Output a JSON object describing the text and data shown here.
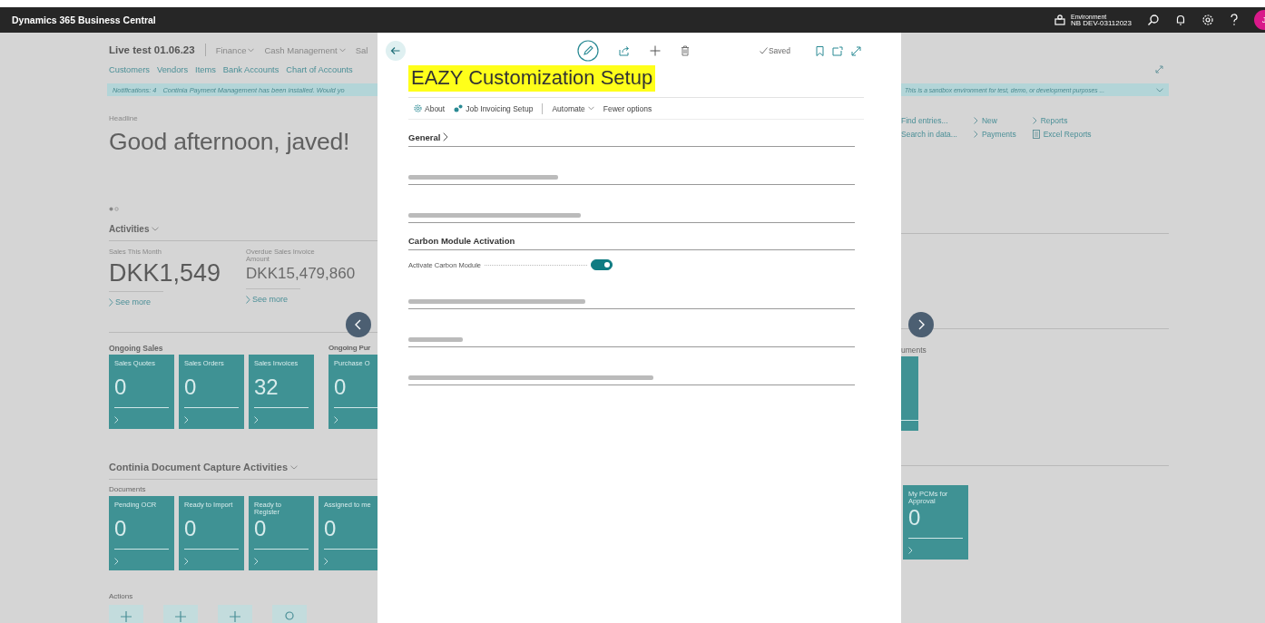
{
  "top_bar": {
    "app_name": "Dynamics 365 Business Central",
    "environment_label": "Environment",
    "environment_name": "NB DEV-03112023",
    "avatar_initial": "J"
  },
  "dashboard": {
    "company": "Live test 01.06.23",
    "menus": [
      {
        "label": "Finance",
        "menu": true
      },
      {
        "label": "Cash Management",
        "menu": true
      },
      {
        "label": "Sal",
        "menu": false
      }
    ],
    "links": [
      "Customers",
      "Vendors",
      "Items",
      "Bank Accounts",
      "Chart of Accounts"
    ],
    "notification": {
      "label": "Notifications: 4",
      "message": "Continia Payment Management has been installed. Would yo"
    },
    "sandbox_banner": "This is a sandbox environment for test, demo, or development purposes ...",
    "quick_links": [
      {
        "items": [
          {
            "label": "Find entries...",
            "kind": "plain"
          },
          {
            "label": "Search in data...",
            "kind": "plain"
          }
        ]
      },
      {
        "items": [
          {
            "label": "New",
            "kind": "link"
          },
          {
            "label": "Payments",
            "kind": "link"
          }
        ]
      },
      {
        "items": [
          {
            "label": "Reports",
            "kind": "link"
          },
          {
            "label": "Excel Reports",
            "kind": "report"
          }
        ]
      }
    ],
    "headline_label": "Headline",
    "greeting": "Good afternoon, javed!",
    "activities": {
      "title": "Activities",
      "cues": [
        {
          "label": "Sales This Month",
          "value": "DKK1,549",
          "link": "See more"
        },
        {
          "label": "Overdue Sales Invoice Amount",
          "value": "DKK15,479,860",
          "link": "See more"
        }
      ]
    },
    "ongoing_sales": {
      "title": "Ongoing Sales",
      "tiles": [
        {
          "label": "Sales Quotes",
          "value": "0"
        },
        {
          "label": "Sales Orders",
          "value": "0"
        },
        {
          "label": "Sales Invoices",
          "value": "32"
        }
      ]
    },
    "ongoing_purchase": {
      "title": "Ongoing Pur",
      "tiles": [
        {
          "label": "Purchase O",
          "value": "0"
        }
      ]
    },
    "documents_heading_end": "uments",
    "document_capture": {
      "title": "Continia Document Capture Activities",
      "group": "Documents",
      "tiles": [
        {
          "label": "Pending OCR",
          "value": "0"
        },
        {
          "label": "Ready to Import",
          "value": "0"
        },
        {
          "label": "Ready to Register",
          "value": "0"
        },
        {
          "label": "Assigned to me",
          "value": "0"
        }
      ],
      "right_tiles": [
        {
          "label": "My PCMs for Approval",
          "value": "0"
        }
      ]
    },
    "actions": {
      "title": "Actions",
      "buttons": [
        {
          "kind": "plus"
        },
        {
          "kind": "plus"
        },
        {
          "kind": "plus"
        },
        {
          "kind": "search"
        }
      ]
    }
  },
  "panel": {
    "title": "EAZY Customization Setup",
    "title_highlighted": true,
    "status": "Saved",
    "actions": [
      {
        "label": "About",
        "kind": "gear"
      },
      {
        "label": "Job Invoicing Setup",
        "kind": "link"
      },
      {
        "label": "Automate",
        "kind": "menu"
      },
      {
        "label": "Fewer options",
        "kind": "plain"
      }
    ],
    "sections": [
      {
        "kind": "heading",
        "title": "General",
        "expanded": false
      },
      {
        "kind": "blurred"
      },
      {
        "kind": "blurred"
      },
      {
        "kind": "heading",
        "title": "Carbon Module Activation",
        "expanded": true,
        "fields": [
          {
            "label": "Activate Carbon Module",
            "on": true
          }
        ]
      },
      {
        "kind": "blurred"
      },
      {
        "kind": "blurred"
      },
      {
        "kind": "blurred"
      }
    ]
  }
}
